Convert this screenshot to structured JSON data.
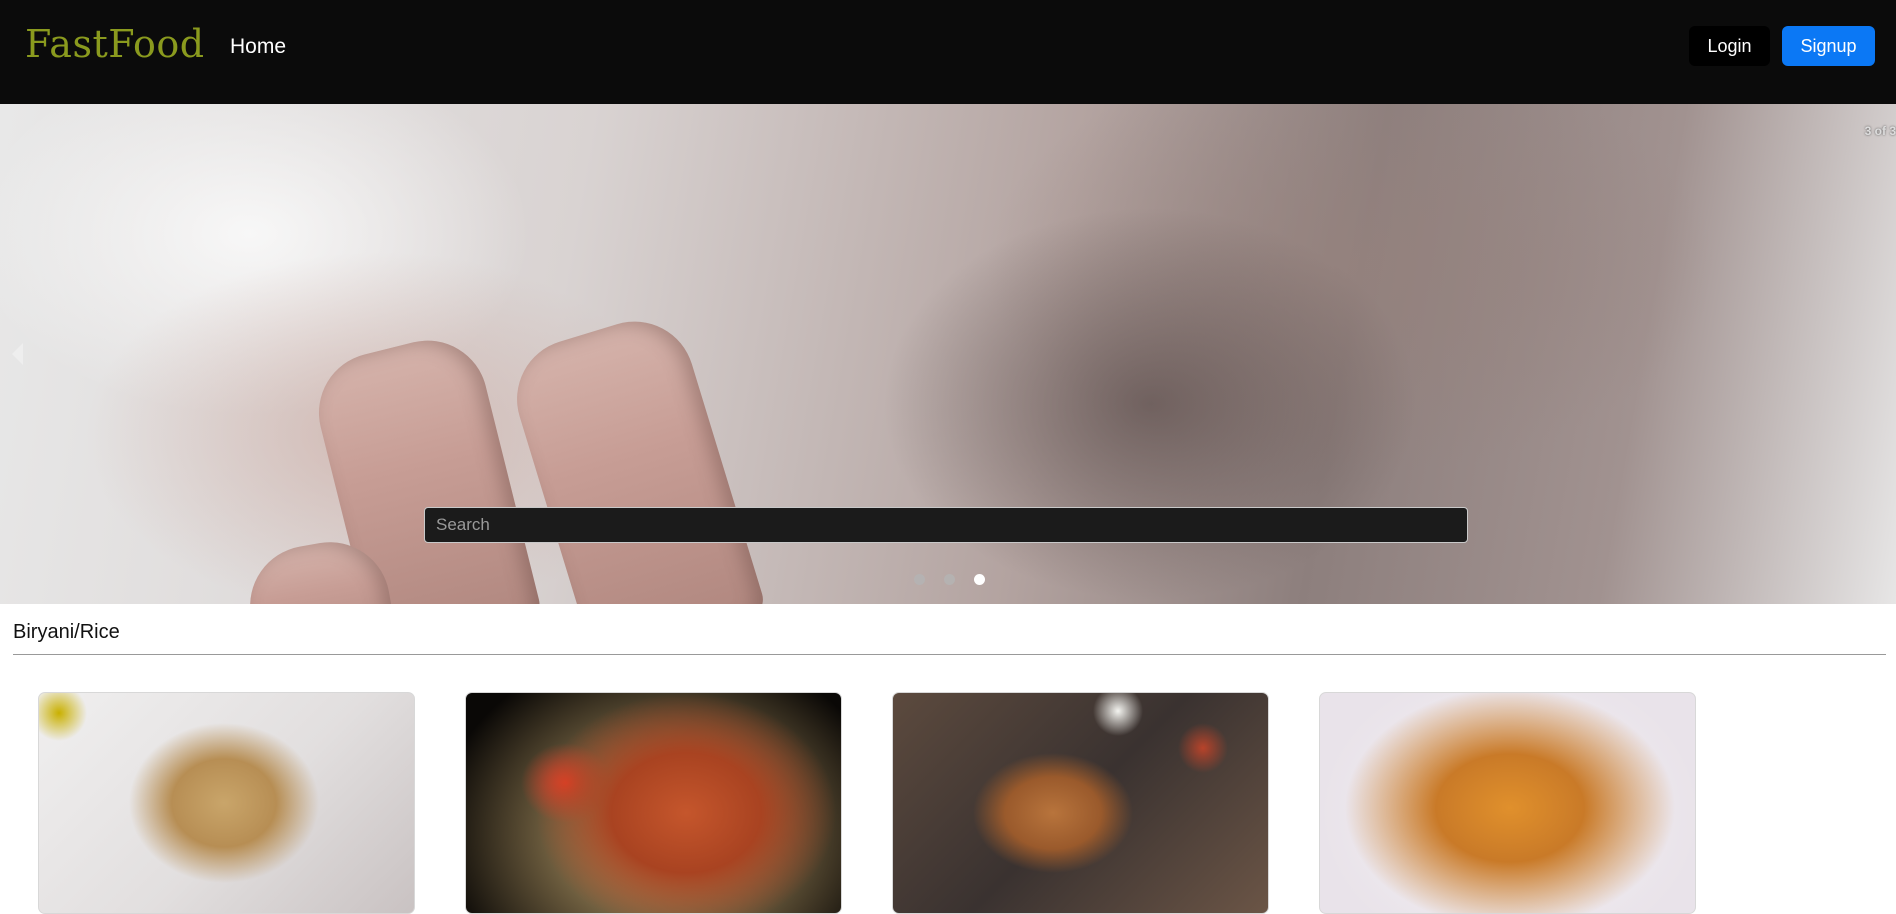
{
  "navbar": {
    "brand": "FastFood",
    "home_link": "Home",
    "login_label": "Login",
    "signup_label": "Signup"
  },
  "carousel": {
    "counter": "3 of 3",
    "search_placeholder": "Search",
    "slide_count": 3,
    "active_slide": 3,
    "prev_icon": "chevron-left-icon"
  },
  "category": {
    "title": "Biryani/Rice",
    "cards": [
      {
        "image": "fried-rice-plate"
      },
      {
        "image": "tomato-rice-platter"
      },
      {
        "image": "biryani-copper-bowl"
      },
      {
        "image": "chicken-biryani-plate"
      }
    ]
  },
  "colors": {
    "navbar_bg": "#0b0b0b",
    "brand": "#8a9a1e",
    "signup_bg": "#0b78f5",
    "login_bg": "#000000"
  }
}
